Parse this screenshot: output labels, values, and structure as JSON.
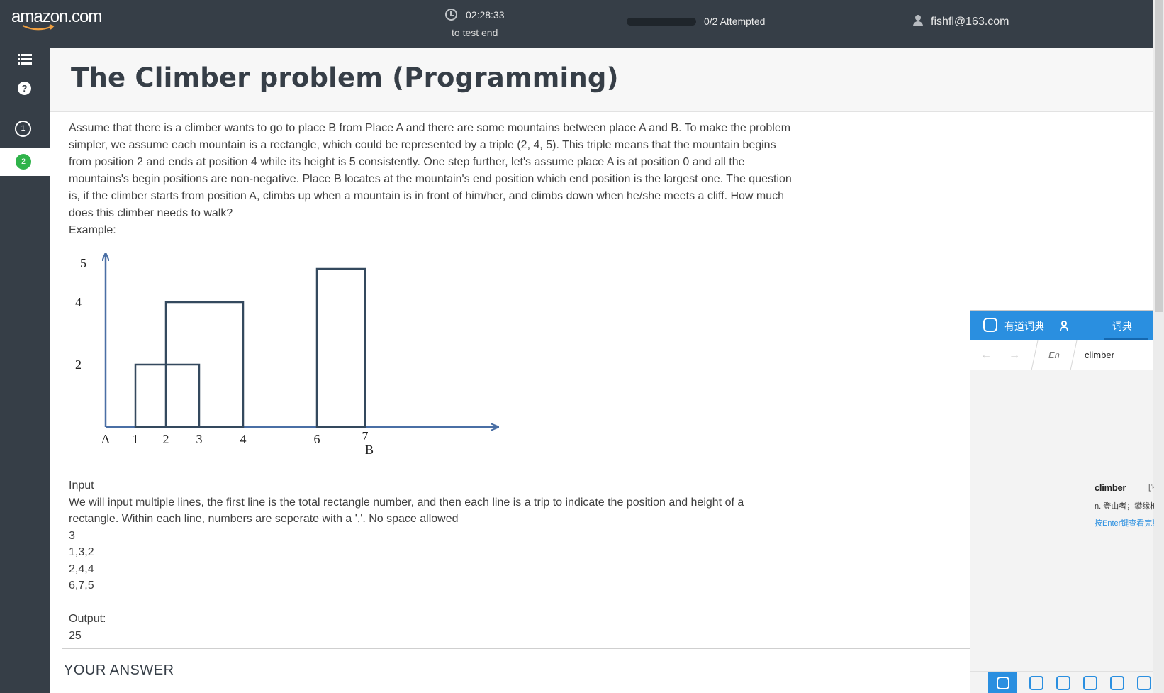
{
  "header": {
    "logo": "amazon.com",
    "timer": "02:28:33",
    "timer_caption": "to test end",
    "progress_label": "0/2 Attempted",
    "progress_fraction": 0,
    "user_email": "fishfl@163.com"
  },
  "sidebar": {
    "items": [
      {
        "icon": "list-icon"
      },
      {
        "icon": "help-icon",
        "label": "?"
      },
      {
        "label": "1",
        "state": "unanswered"
      },
      {
        "label": "2",
        "state": "current"
      }
    ]
  },
  "problem": {
    "title": "The Climber problem (Programming)",
    "description": "Assume that there is a climber wants to go to place B from Place A and there are some mountains between place A and B. To make the problem simpler, we assume each mountain is a rectangle, which could be represented by a triple (2, 4, 5). This triple means that the mountain begins from position 2 and ends at position 4 while its height is 5 consistently. One step further, let's assume place A is at position 0 and all the mountains's begin positions are non-negative. Place B locates at the mountain's end position which end position is the largest one. The question is, if the climber starts from position A, climbs up when a mountain is in front of him/her, and climbs down when he/she meets a cliff. How much does this climber needs to walk?",
    "example_label": "Example:",
    "input_label": "Input",
    "input_description": "We will input multiple lines, the first line is the total rectangle number,  and then each line is a trip to indicate the position and height of a rectangle. Within each line, numbers are seperate with a ','. No space allowed",
    "input_lines": [
      "3",
      "1,3,2",
      "2,4,4",
      "6,7,5"
    ],
    "output_label": "Output:",
    "output_value": "25",
    "answer_heading": "YOUR ANSWER"
  },
  "chart_data": {
    "type": "diagram",
    "rectangles": [
      {
        "start": 1,
        "end": 3,
        "height": 2
      },
      {
        "start": 2,
        "end": 4,
        "height": 4
      },
      {
        "start": 6,
        "end": 7,
        "height": 5
      }
    ],
    "x_tick_labels": [
      {
        "value": 0,
        "label": "A"
      },
      {
        "value": 1,
        "label": "1"
      },
      {
        "value": 2,
        "label": "2"
      },
      {
        "value": 3,
        "label": "3"
      },
      {
        "value": 4,
        "label": "4"
      },
      {
        "value": 6,
        "label": "6"
      },
      {
        "value": 7,
        "label": "7"
      }
    ],
    "end_marker": {
      "value": 7,
      "label": "B"
    },
    "y_tick_labels": [
      {
        "value": 2,
        "label": "2"
      },
      {
        "value": 4,
        "label": "4"
      },
      {
        "value": 5,
        "label": "5"
      }
    ],
    "colors": {
      "axis": "#4a6fa5",
      "rect": "#34495e"
    }
  },
  "dictionary": {
    "app_name": "有道词典",
    "tab_label": "词典",
    "lang": "En",
    "query": "climber",
    "headword": "climber",
    "phonetic": "['kla",
    "definition": "n. 登山者；攀缘植",
    "hint": "按Enter键查看完整",
    "accent": "#2a8fe0"
  }
}
